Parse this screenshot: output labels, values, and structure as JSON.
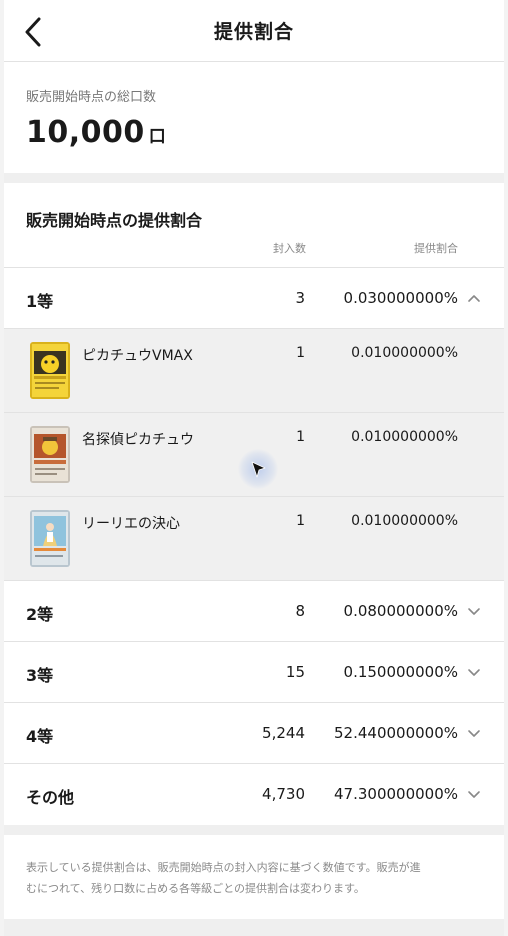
{
  "header": {
    "title": "提供割合"
  },
  "total": {
    "label": "販売開始時点の総口数",
    "value": "10,000",
    "unit": "口"
  },
  "ratio": {
    "title": "販売開始時点の提供割合",
    "col_count": "封入数",
    "col_rate": "提供割合",
    "ranks": [
      {
        "name": "1等",
        "count": "3",
        "rate": "0.030000000%",
        "expanded": true
      },
      {
        "name": "2等",
        "count": "8",
        "rate": "0.080000000%",
        "expanded": false
      },
      {
        "name": "3等",
        "count": "15",
        "rate": "0.150000000%",
        "expanded": false
      },
      {
        "name": "4等",
        "count": "5,244",
        "rate": "52.440000000%",
        "expanded": false
      },
      {
        "name": "その他",
        "count": "4,730",
        "rate": "47.300000000%",
        "expanded": false
      }
    ],
    "cards": [
      {
        "name": "ピカチュウVMAX",
        "count": "1",
        "rate": "0.010000000%"
      },
      {
        "name": "名探偵ピカチュウ",
        "count": "1",
        "rate": "0.010000000%"
      },
      {
        "name": "リーリエの決心",
        "count": "1",
        "rate": "0.010000000%"
      }
    ]
  },
  "note": {
    "line1": "表示している提供割合は、販売開始時点の封入内容に基づく数値です。販売が進",
    "line2": "むにつれて、残り口数に占める各等級ごとの提供割合は変わります。"
  },
  "icons": {
    "back": "back-arrow-icon",
    "chevron_up": "chevron-up-icon",
    "chevron_down": "chevron-down-icon"
  },
  "colors": {
    "text": "#1a1a1a",
    "muted": "#888888",
    "divider": "#e2e2e2",
    "expanded_bg": "#f0f0f0"
  }
}
